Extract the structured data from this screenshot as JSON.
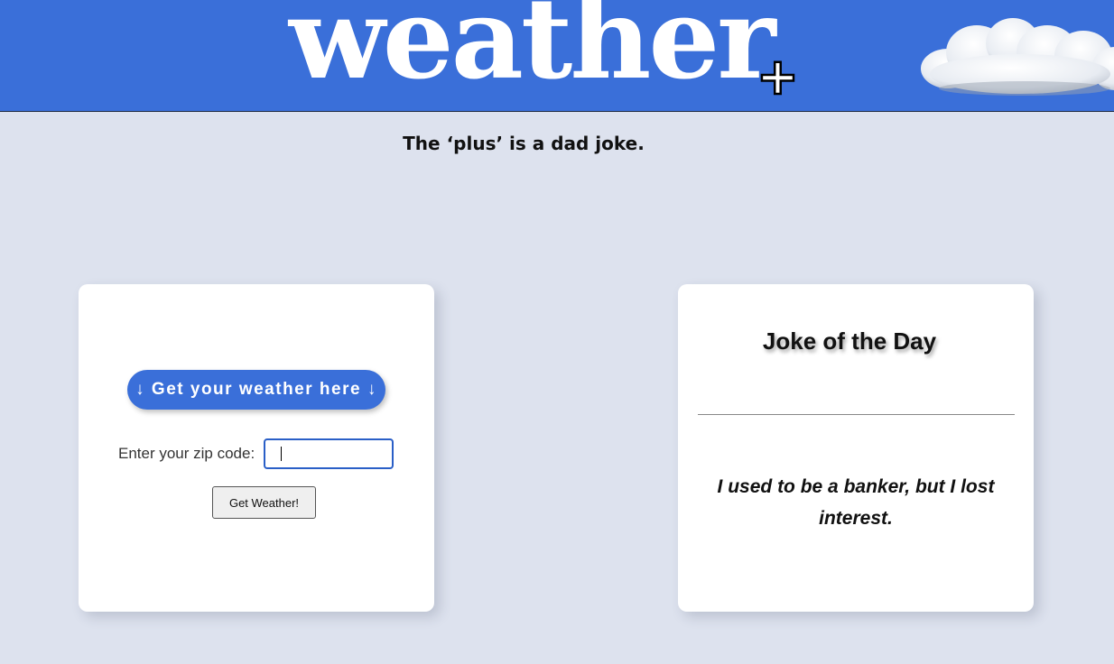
{
  "header": {
    "logo_text": "weather",
    "logo_plus": "+",
    "brand_color": "#3a6fd9"
  },
  "tagline": "The ‘plus’ is a dad joke.",
  "weather_card": {
    "heading": "↓ Get your weather here ↓",
    "zip_label": "Enter your zip code:",
    "zip_value": "",
    "submit_label": "Get Weather!"
  },
  "joke_card": {
    "title": "Joke of the Day",
    "joke": "I used to be a banker, but I lost interest."
  },
  "icons": {
    "cloud": "cloud-icon"
  }
}
